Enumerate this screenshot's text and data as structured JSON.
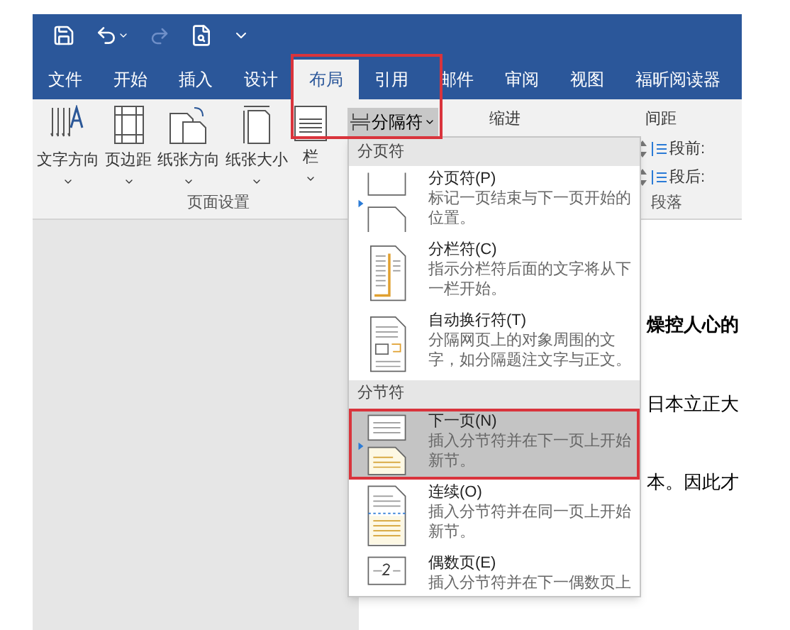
{
  "quick_access": [
    {
      "kind": "save",
      "disabled": false
    },
    {
      "kind": "undo",
      "disabled": false
    },
    {
      "kind": "redo",
      "disabled": true
    },
    {
      "kind": "preview",
      "disabled": false
    },
    {
      "kind": "customize",
      "disabled": false
    }
  ],
  "tabs": [
    {
      "label": "文件",
      "selected": false
    },
    {
      "label": "开始",
      "selected": false
    },
    {
      "label": "插入",
      "selected": false
    },
    {
      "label": "设计",
      "selected": false
    },
    {
      "label": "布局",
      "selected": true
    },
    {
      "label": "引用",
      "selected": false
    },
    {
      "label": "邮件",
      "selected": false
    },
    {
      "label": "审阅",
      "selected": false
    },
    {
      "label": "视图",
      "selected": false
    },
    {
      "label": "福昕阅读器",
      "selected": false
    }
  ],
  "ribbon": {
    "page_setup": {
      "buttons": [
        {
          "kind": "text_direction",
          "label": "文字方向"
        },
        {
          "kind": "margins",
          "label": "页边距"
        },
        {
          "kind": "orientation",
          "label": "纸张方向"
        },
        {
          "kind": "size",
          "label": "纸张大小"
        },
        {
          "kind": "columns",
          "label": "栏"
        }
      ],
      "group_label": "页面设置"
    },
    "breaks_button": {
      "label": "分隔符",
      "open": true
    },
    "indent_label": "缩进",
    "spacing_label": "间距",
    "spacing_fields": [
      {
        "label": "段前:"
      },
      {
        "label": "段后:"
      }
    ],
    "paragraph_label": "段落"
  },
  "document": {
    "lines": [
      {
        "text": "燥控人心的",
        "bold": true
      },
      {
        "text": "日本立正大",
        "bold": false
      },
      {
        "text": "本。因此才",
        "bold": false
      }
    ]
  },
  "breaks_menu": {
    "sections": [
      {
        "header": "分页符",
        "items": [
          {
            "kind": "page",
            "title": "分页符(P)",
            "description": "标记一页结束与下一页开始的位置。",
            "selected": false
          },
          {
            "kind": "column",
            "title": "分栏符(C)",
            "description": "指示分栏符后面的文字将从下一栏开始。",
            "selected": false
          },
          {
            "kind": "wrap",
            "title": "自动换行符(T)",
            "description": "分隔网页上的对象周围的文字，如分隔题注文字与正文。",
            "selected": false
          }
        ]
      },
      {
        "header": "分节符",
        "items": [
          {
            "kind": "next",
            "title": "下一页(N)",
            "description": "插入分节符并在下一页上开始新节。",
            "selected": true
          },
          {
            "kind": "continuous",
            "title": "连续(O)",
            "description": "插入分节符并在同一页上开始新节。",
            "selected": false
          },
          {
            "kind": "even",
            "title": "偶数页(E)",
            "description": "插入分节符并在下一偶数页上",
            "selected": false
          }
        ]
      }
    ]
  }
}
